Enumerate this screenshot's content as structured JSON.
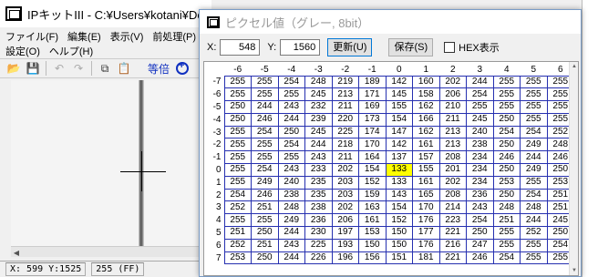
{
  "main_window": {
    "title": "IPキットIII - C:¥Users¥kotani¥Desktop",
    "menu_row1": [
      "ファイル(F)",
      "編集(E)",
      "表示(V)",
      "前処理(P)",
      "画像"
    ],
    "menu_row2": [
      "設定(O)",
      "ヘルプ(H)"
    ],
    "toolbar": {
      "zoom_label": "等倍"
    },
    "status": {
      "coords": "X: 599 Y:1525",
      "value": "255 (FF)"
    }
  },
  "dialog": {
    "title": "ピクセル値（グレー, 8bit）",
    "x_label": "X:",
    "x_value": "548",
    "y_label": "Y:",
    "y_value": "1560",
    "refresh_button": "更新(U)",
    "save_button": "保存(S)",
    "hex_label": "HEX表示",
    "hex_checked": false,
    "col_headers": [
      "-6",
      "-5",
      "-4",
      "-3",
      "-2",
      "-1",
      "0",
      "1",
      "2",
      "3",
      "4",
      "5",
      "6"
    ],
    "row_headers": [
      "-7",
      "-6",
      "-5",
      "-4",
      "-3",
      "-2",
      "-1",
      "0",
      "1",
      "2",
      "3",
      "4",
      "5",
      "6",
      "7"
    ],
    "highlight": {
      "row": "0",
      "col": "0",
      "color": "#ffff00"
    },
    "grid_color": "#2630b0",
    "rows": [
      [
        "255",
        "255",
        "254",
        "248",
        "219",
        "189",
        "142",
        "160",
        "202",
        "244",
        "255",
        "255",
        "255"
      ],
      [
        "255",
        "255",
        "255",
        "245",
        "213",
        "171",
        "145",
        "158",
        "206",
        "254",
        "255",
        "255",
        "255"
      ],
      [
        "250",
        "244",
        "243",
        "232",
        "211",
        "169",
        "155",
        "162",
        "210",
        "255",
        "255",
        "255",
        "255"
      ],
      [
        "250",
        "246",
        "244",
        "239",
        "220",
        "173",
        "154",
        "166",
        "211",
        "245",
        "250",
        "255",
        "255"
      ],
      [
        "255",
        "254",
        "250",
        "245",
        "225",
        "174",
        "147",
        "162",
        "213",
        "240",
        "254",
        "254",
        "252"
      ],
      [
        "255",
        "255",
        "254",
        "244",
        "218",
        "170",
        "142",
        "161",
        "213",
        "238",
        "250",
        "249",
        "248"
      ],
      [
        "255",
        "255",
        "255",
        "243",
        "211",
        "164",
        "137",
        "157",
        "208",
        "234",
        "246",
        "244",
        "246"
      ],
      [
        "255",
        "254",
        "243",
        "233",
        "202",
        "154",
        "133",
        "155",
        "201",
        "234",
        "250",
        "249",
        "250"
      ],
      [
        "255",
        "249",
        "240",
        "235",
        "203",
        "152",
        "133",
        "161",
        "202",
        "234",
        "253",
        "255",
        "253"
      ],
      [
        "254",
        "246",
        "238",
        "235",
        "203",
        "159",
        "143",
        "165",
        "208",
        "236",
        "250",
        "254",
        "251"
      ],
      [
        "252",
        "251",
        "248",
        "238",
        "202",
        "163",
        "154",
        "170",
        "214",
        "243",
        "248",
        "248",
        "251"
      ],
      [
        "255",
        "255",
        "249",
        "236",
        "206",
        "161",
        "152",
        "176",
        "223",
        "254",
        "251",
        "244",
        "245"
      ],
      [
        "251",
        "250",
        "244",
        "230",
        "197",
        "153",
        "150",
        "177",
        "221",
        "250",
        "255",
        "252",
        "250"
      ],
      [
        "252",
        "251",
        "243",
        "225",
        "193",
        "150",
        "150",
        "176",
        "216",
        "247",
        "255",
        "255",
        "254"
      ],
      [
        "253",
        "250",
        "244",
        "226",
        "196",
        "156",
        "151",
        "181",
        "221",
        "246",
        "254",
        "255",
        "255"
      ]
    ]
  }
}
